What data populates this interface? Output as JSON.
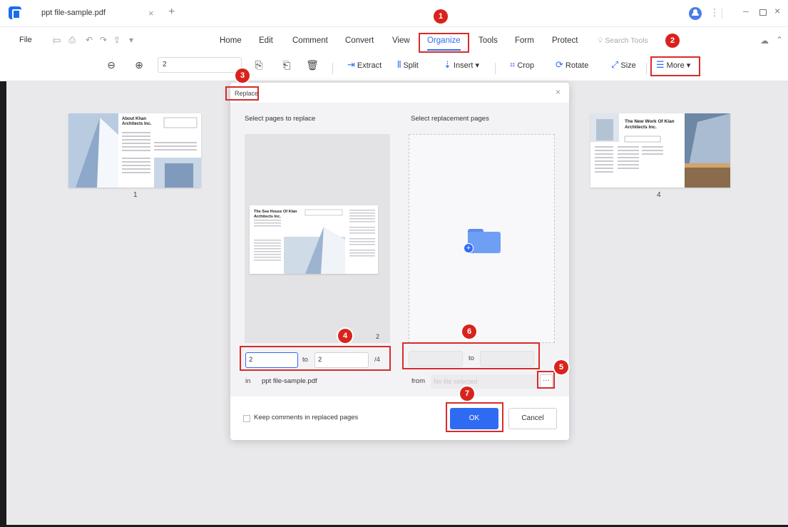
{
  "window": {
    "tab_title": "ppt file-sample.pdf",
    "tab_close": "×",
    "tab_add": "+",
    "more": "⋮",
    "minimize": "–",
    "close": "×"
  },
  "menubar": {
    "file": "File",
    "items": [
      "Home",
      "Edit",
      "Comment",
      "Convert",
      "View",
      "Organize",
      "Tools",
      "Form",
      "Protect"
    ],
    "active": "Organize",
    "search_tools": "Search Tools"
  },
  "toolbar": {
    "zoom_value": "2",
    "extract": "Extract",
    "split": "Split",
    "insert": "Insert",
    "crop": "Crop",
    "rotate": "Rotate",
    "size": "Size",
    "more": "More"
  },
  "thumbnails": [
    {
      "page": "1",
      "title": "About Khan Architects Inc."
    },
    {
      "page": "4",
      "title": "The New Work Of Klan Architects Inc."
    }
  ],
  "dialog": {
    "title": "Replace",
    "left_label": "Select pages to replace",
    "right_label": "Select replacement pages",
    "preview_title": "The Sea House Of Klan Architects Inc.",
    "preview_page": "2",
    "from_page": "2",
    "to_label": "to",
    "to_page": "2",
    "total_pages": "/4",
    "in_label": "in",
    "file_name": "ppt file-sample.pdf",
    "repl_to_label": "to",
    "from_label": "from",
    "from_placeholder": "No file selected",
    "browse": "···",
    "keep_comments": "Keep comments in replaced pages",
    "ok": "OK",
    "cancel": "Cancel"
  },
  "annotations": [
    "1",
    "2",
    "3",
    "4",
    "5",
    "6",
    "7"
  ],
  "colors": {
    "accent": "#2f6bf2",
    "highlight": "#d82b2b",
    "badge": "#d8231c"
  }
}
